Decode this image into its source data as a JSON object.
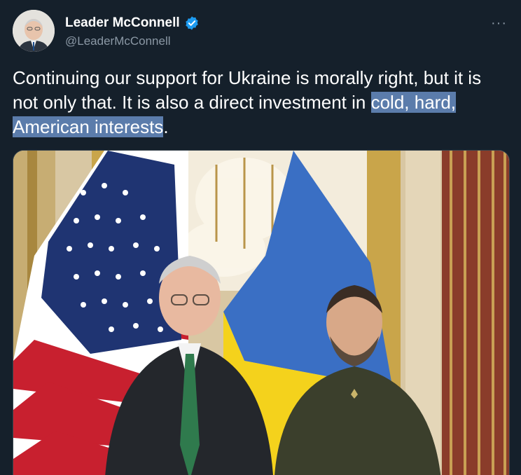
{
  "author": {
    "display_name": "Leader McConnell",
    "handle": "@LeaderMcConnell",
    "verified": true,
    "avatar_icon": "profile-photo"
  },
  "menu": {
    "more_icon": "···"
  },
  "tweet": {
    "text_before": "Continuing our support for Ukraine is morally right, but it is not only that. It is also a direct investment in ",
    "text_highlight": "cold, hard, American interests",
    "text_after": "."
  },
  "colors": {
    "background": "#15202b",
    "secondary_text": "#8b98a5",
    "verified_blue": "#1d9bf0",
    "highlight": "#5b7cab"
  },
  "media": {
    "type": "photo",
    "alt_icon": "photo-image"
  }
}
